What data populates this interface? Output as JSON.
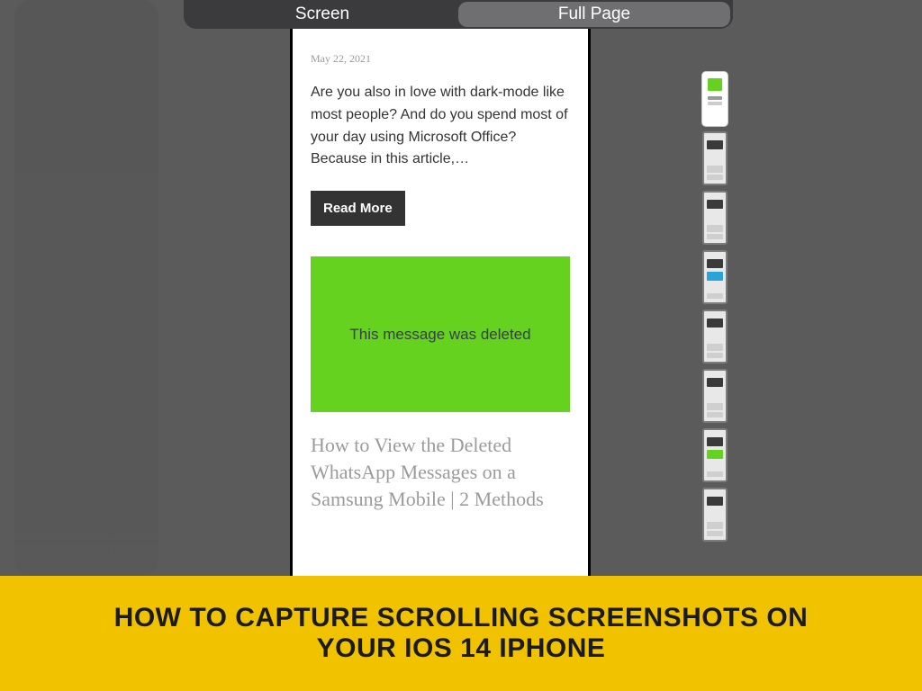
{
  "segmented": {
    "screen": "Screen",
    "full_page": "Full Page"
  },
  "article1": {
    "date": "May 22, 2021",
    "excerpt": "Are you also in love with dark-mode like most people? And do you spend most of your day using Microsoft Office? Because in this article,…",
    "read_more": "Read More"
  },
  "deleted_card": {
    "text": "This message was deleted"
  },
  "article2": {
    "title": "How to View the Deleted WhatsApp Messages on a Samsung Mobile | 2 Methods"
  },
  "caption": {
    "text": "How to Capture Scrolling Screenshots on Your iOS 14 iPhone"
  },
  "colors": {
    "accent_green": "#64d21e",
    "caption_yellow": "#f0c200",
    "bg_gray": "#5b5b5b"
  }
}
